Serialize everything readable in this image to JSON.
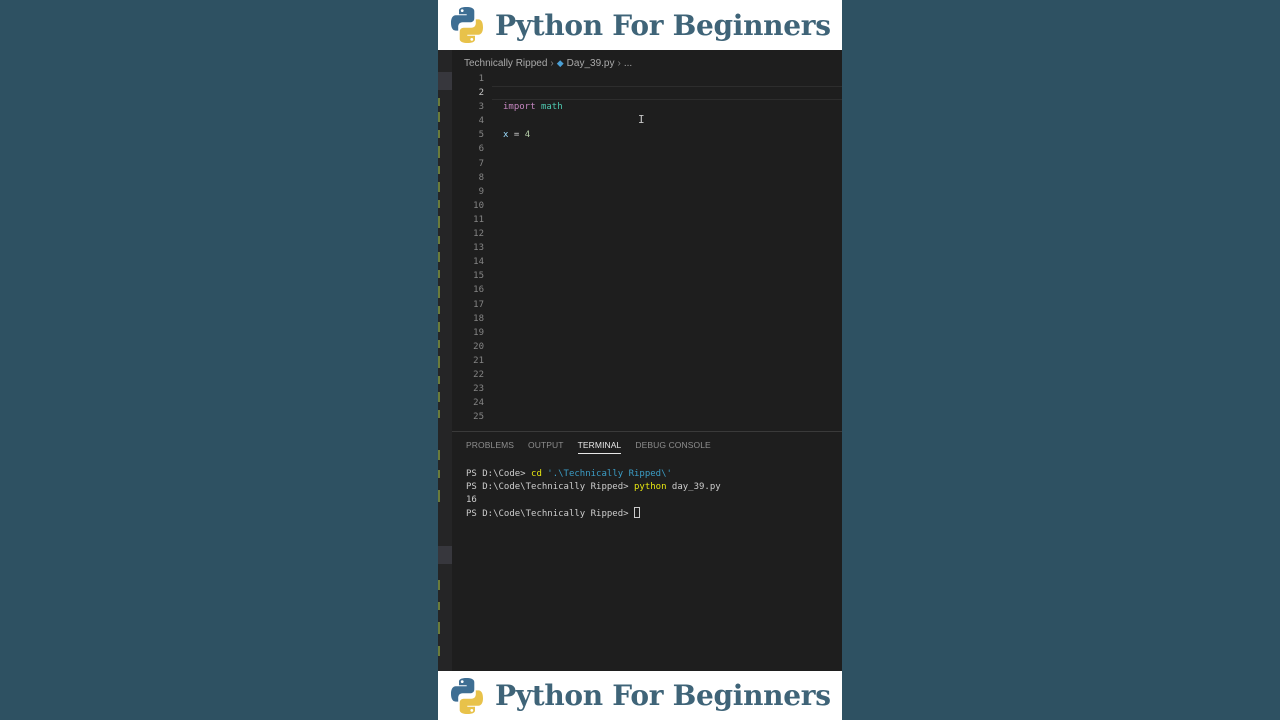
{
  "banner": {
    "title": "Python For Beginners"
  },
  "editor": {
    "breadcrumb": {
      "folder": "Technically Ripped",
      "file": "Day_39.py",
      "more": "..."
    },
    "line_numbers": [
      "1",
      "2",
      "3",
      "4",
      "5",
      "6",
      "7",
      "8",
      "9",
      "10",
      "11",
      "12",
      "13",
      "14",
      "15",
      "16",
      "17",
      "18",
      "19",
      "20",
      "21",
      "22",
      "23",
      "24",
      "25"
    ],
    "active_line": "2",
    "code": {
      "line3_keyword": "import",
      "line3_module": "math",
      "line5_var": "x",
      "line5_op": " = ",
      "line5_value": "4"
    }
  },
  "panel": {
    "tabs": [
      "PROBLEMS",
      "OUTPUT",
      "TERMINAL",
      "DEBUG CONSOLE"
    ],
    "active_tab": "TERMINAL",
    "terminal": {
      "l1_prompt": "PS D:\\Code> ",
      "l1_cmd": "cd",
      "l1_arg": " '.\\Technically Ripped\\'",
      "l2_prompt": "PS D:\\Code\\Technically Ripped> ",
      "l2_cmd": "python",
      "l2_arg": " day_39.py",
      "l3_output": "16",
      "l4_prompt": "PS D:\\Code\\Technically Ripped> "
    }
  },
  "icons": {
    "logo": "python-logo",
    "file": "python-file-icon"
  }
}
